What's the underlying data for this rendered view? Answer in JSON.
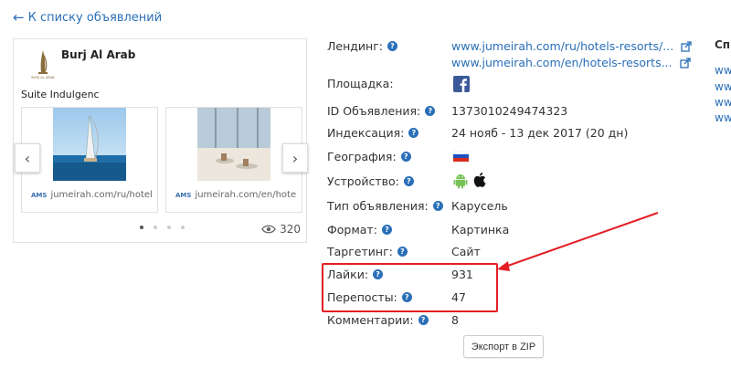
{
  "back_link": "К списку объявлений",
  "ad": {
    "brand_name": "Burj Al Arab",
    "logo_text": "BURJ AL ARAB",
    "text": "Suite Indulgenc",
    "slides": [
      {
        "caption": "jumeirah.com/ru/hotel",
        "source_logo": "AMS"
      },
      {
        "caption": "jumeirah.com/en/hote",
        "source_logo": "AMS"
      }
    ],
    "views": "320"
  },
  "details": {
    "landing_label": "Лендинг:",
    "landing_links": [
      "www.jumeirah.com/ru/hotels-resorts/...",
      "www.jumeirah.com/en/hotels-resorts..."
    ],
    "platform_label": "Площадка:",
    "platform_icon": "facebook-icon",
    "id_label": "ID Объявления:",
    "id_value": "1373010249474323",
    "indexing_label": "Индексация:",
    "indexing_value": "24 нояб - 13 дек 2017 (20 дн)",
    "geo_label": "География:",
    "geo_icon": "russia-flag-icon",
    "device_label": "Устройство:",
    "device_icons": [
      "android-icon",
      "apple-icon"
    ],
    "type_label": "Тип объявления:",
    "type_value": "Карусель",
    "format_label": "Формат:",
    "format_value": "Картинка",
    "targeting_label": "Таргетинг:",
    "targeting_value": "Сайт",
    "likes_label": "Лайки:",
    "likes_value": "931",
    "reposts_label": "Перепосты:",
    "reposts_value": "47",
    "comments_label": "Комментарии:",
    "comments_value": "8",
    "help_glyph": "?"
  },
  "export_button": "Экспорт в ZIP",
  "right_column": {
    "title": "Сп",
    "links": [
      "ww",
      "ww",
      "ww",
      "ww"
    ]
  },
  "colors": {
    "accent": "#2a6fb8",
    "highlight": "#e31e24"
  }
}
